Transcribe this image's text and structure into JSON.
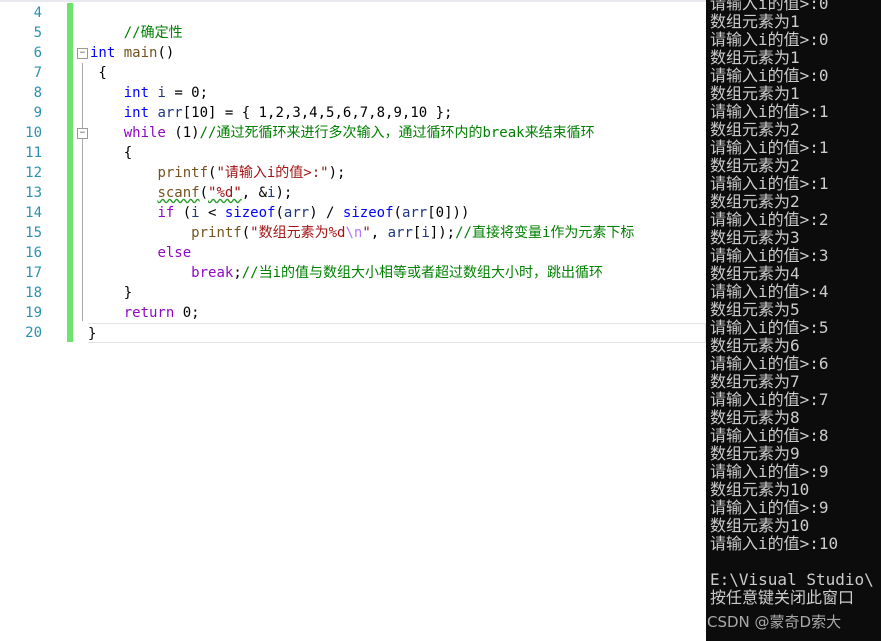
{
  "editor": {
    "line_numbers": [
      "4",
      "5",
      "6",
      "7",
      "8",
      "9",
      "10",
      "11",
      "12",
      "13",
      "14",
      "15",
      "16",
      "17",
      "18",
      "19",
      "20"
    ],
    "lines": [
      [],
      [
        [
          "cm",
          "    //确定性"
        ]
      ],
      [
        [
          "kw",
          "int"
        ],
        [
          "p",
          " "
        ],
        [
          "fn",
          "main"
        ],
        [
          "p",
          "()"
        ]
      ],
      [
        [
          "p",
          " {"
        ]
      ],
      [
        [
          "p",
          "    "
        ],
        [
          "kw",
          "int"
        ],
        [
          "p",
          " "
        ],
        [
          "var",
          "i"
        ],
        [
          "p",
          " = 0;"
        ]
      ],
      [
        [
          "p",
          "    "
        ],
        [
          "kw",
          "int"
        ],
        [
          "p",
          " "
        ],
        [
          "var",
          "arr"
        ],
        [
          "p",
          "[10] = { 1,2,3,4,5,6,7,8,9,10 };"
        ]
      ],
      [
        [
          "p",
          "    "
        ],
        [
          "kw2",
          "while"
        ],
        [
          "p",
          " (1)"
        ],
        [
          "cm",
          "//通过死循环来进行多次输入，通过循环内的break来结束循环"
        ]
      ],
      [
        [
          "p",
          "    {"
        ]
      ],
      [
        [
          "p",
          "        "
        ],
        [
          "fn",
          "printf"
        ],
        [
          "p",
          "("
        ],
        [
          "st",
          "\"请输入i的值>:\""
        ],
        [
          "p",
          ");"
        ]
      ],
      [
        [
          "p",
          "        "
        ],
        [
          "fn",
          "scanf"
        ],
        [
          "p",
          "("
        ],
        [
          "st",
          "\"%d\""
        ],
        [
          "p",
          ", &"
        ],
        [
          "var",
          "i"
        ],
        [
          "p",
          ");"
        ]
      ],
      [
        [
          "p",
          "        "
        ],
        [
          "kw2",
          "if"
        ],
        [
          "p",
          " ("
        ],
        [
          "var",
          "i"
        ],
        [
          "p",
          " < "
        ],
        [
          "kw",
          "sizeof"
        ],
        [
          "p",
          "("
        ],
        [
          "var",
          "arr"
        ],
        [
          "p",
          ") / "
        ],
        [
          "kw",
          "sizeof"
        ],
        [
          "p",
          "("
        ],
        [
          "var",
          "arr"
        ],
        [
          "p",
          "[0]))"
        ]
      ],
      [
        [
          "p",
          "            "
        ],
        [
          "fn",
          "printf"
        ],
        [
          "p",
          "("
        ],
        [
          "st",
          "\"数组元素为%d"
        ],
        [
          "esc",
          "\\n"
        ],
        [
          "st",
          "\""
        ],
        [
          "p",
          ", "
        ],
        [
          "var",
          "arr"
        ],
        [
          "p",
          "["
        ],
        [
          "var",
          "i"
        ],
        [
          "p",
          "]);"
        ],
        [
          "cm",
          "//直接将变量i作为元素下标"
        ]
      ],
      [
        [
          "p",
          "        "
        ],
        [
          "kw2",
          "else"
        ]
      ],
      [
        [
          "p",
          "            "
        ],
        [
          "kw2",
          "break"
        ],
        [
          "p",
          ";"
        ],
        [
          "cm",
          "//当i的值与数组大小相等或者超过数组大小时，跳出循环"
        ]
      ],
      [
        [
          "p",
          "    }"
        ]
      ],
      [
        [
          "p",
          "    "
        ],
        [
          "kw2",
          "return"
        ],
        [
          "p",
          " 0;"
        ]
      ],
      [
        [
          "p",
          "}"
        ]
      ]
    ]
  },
  "console": {
    "lines": [
      "请输入i的值>:0",
      "数组元素为1",
      "请输入i的值>:0",
      "数组元素为1",
      "请输入i的值>:0",
      "数组元素为1",
      "请输入i的值>:1",
      "数组元素为2",
      "请输入i的值>:1",
      "数组元素为2",
      "请输入i的值>:1",
      "数组元素为2",
      "请输入i的值>:2",
      "数组元素为3",
      "请输入i的值>:3",
      "数组元素为4",
      "请输入i的值>:4",
      "数组元素为5",
      "请输入i的值>:5",
      "数组元素为6",
      "请输入i的值>:6",
      "数组元素为7",
      "请输入i的值>:7",
      "数组元素为8",
      "请输入i的值>:8",
      "数组元素为9",
      "请输入i的值>:9",
      "数组元素为10",
      "请输入i的值>:9",
      "数组元素为10",
      "请输入i的值>:10",
      "",
      "E:\\Visual Studio\\",
      "按任意键关闭此窗口"
    ]
  },
  "watermark": "CSDN @蒙奇D索大"
}
